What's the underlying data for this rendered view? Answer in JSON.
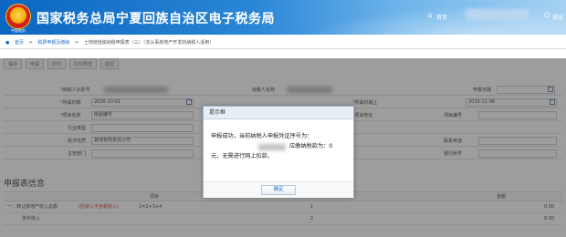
{
  "header": {
    "emblem_text": "中国税务",
    "title": "国家税务总局宁夏回族自治区电子税务局",
    "home": "首页",
    "logout": "退出"
  },
  "breadcrumb": {
    "home": "首页",
    "level1": "税费申报及缴纳",
    "level2": "土地增值税纳税申报表（三）（非从事房地产开发的纳税人适用）"
  },
  "toolbar": {
    "buttons": [
      "保存",
      "申报",
      "打印",
      "打印预览",
      "返回"
    ]
  },
  "form": {
    "taxpayer_id_label": "纳税人识别号",
    "taxpayer_name_label": "纳税人名称",
    "declare_date_label": "申报日期",
    "period_start_label": "所属时期",
    "period_start_value": "2016-10-01",
    "period_end_label": "所属时期止",
    "period_end_value": "2016-11-06",
    "project_name_label": "项目名称",
    "project_name_value": "房屋编号",
    "project_address_label": "项目地址",
    "project_no_label": "项目编号",
    "industry_label": "行业类型",
    "economic_type_label": "经济性质",
    "economic_type_value": "其他有限责任公司",
    "contact_label": "联系电话",
    "dept_label": "主管部门",
    "bank_label": "银行账号"
  },
  "section_title": "申报表信息",
  "table": {
    "col_item": "项目",
    "col_amount": "金额",
    "rows": [
      {
        "label": "一、转让房地产收入总额",
        "red": "(应纳入不含税收入)",
        "formula": "1=2+3+4",
        "no": "1",
        "value": "0.00"
      },
      {
        "label": "货币收入",
        "red": "",
        "formula": "",
        "no": "2",
        "value": "0.00"
      }
    ]
  },
  "dialog": {
    "title": "提示框",
    "line1": "申报成功，当前纳税人申报凭证序号为：",
    "line2": "应缴纳税款为：0",
    "line3": "元，无需进行网上扣款。",
    "ok": "确定"
  }
}
